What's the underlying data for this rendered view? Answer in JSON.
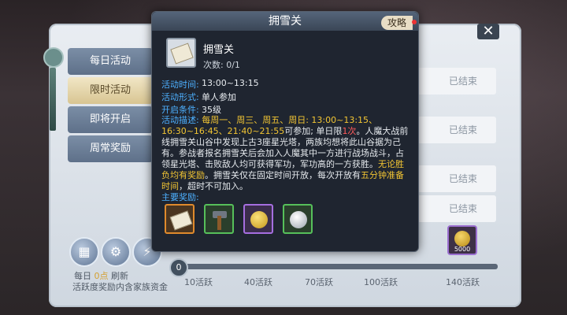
{
  "activity_panel": {
    "tabs": [
      {
        "label": "每日活动"
      },
      {
        "label": "限时活动"
      },
      {
        "label": "即将开启"
      },
      {
        "label": "周常奖励"
      }
    ],
    "row_status": [
      "已结束",
      "已结束",
      "已结束",
      "已结束"
    ],
    "close_label": "✕",
    "daily_prefix": "每日",
    "daily_points": "0点",
    "daily_suffix": "刷新",
    "fund_text": "活跃度奖励内含家族资金",
    "progress_badge": "0",
    "progress_value": 0,
    "milestones": [
      "10活跃",
      "40活跃",
      "70活跃",
      "100活跃",
      "140活跃"
    ],
    "coin_amount": "5000"
  },
  "popup": {
    "title": "拥雪关",
    "guide_button": "攻略",
    "name": "拥雪关",
    "count": "次数: 0/1",
    "time_label": "活动时间:",
    "time_value": "13:00~13:15",
    "form_label": "活动形式:",
    "form_value": "单人参加",
    "condition_label": "开启条件:",
    "condition_value": "35级",
    "desc_label": "活动描述:",
    "desc_schedule": "每周一、周三、周五、周日: 13:00~13:15、16:30~16:45、21:40~21:55",
    "desc_part1": "可参加; 单日限",
    "desc_limit": "1次",
    "desc_part2": "。人魔大战前线拥雪关山谷中发现上古3座星光塔，两族均想将此山谷据为己有。参战者报名拥雪关后会加入人魔其中一方进行战场战斗，占领星光塔、击败敌人均可获得军功，军功高的一方获胜。",
    "desc_highlight": "无论胜负均有奖励",
    "desc_part3": "。拥雪关仅在固定时间开放，每次开放有",
    "desc_prep": "五分钟准备时间",
    "desc_part4": "，超时不可加入。",
    "rewards_label": "主要奖励:"
  },
  "colors": {
    "accent_blue": "#4db0ff",
    "highlight_yellow": "#f2c533",
    "highlight_red": "#ff5c5c"
  }
}
